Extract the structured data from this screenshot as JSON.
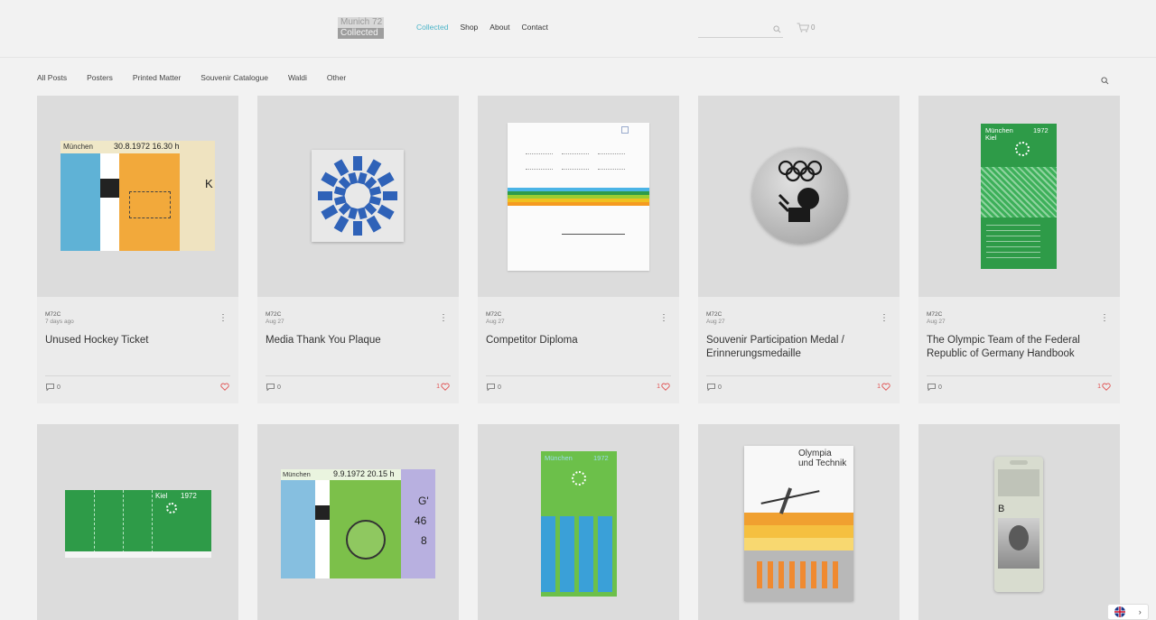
{
  "header": {
    "logo_line1": "Munich 72",
    "logo_line2": "Collected",
    "nav": [
      {
        "label": "Collected",
        "active": true
      },
      {
        "label": "Shop",
        "active": false
      },
      {
        "label": "About",
        "active": false
      },
      {
        "label": "Contact",
        "active": false
      }
    ],
    "cart_count": "0",
    "accent_color": "#4bb4c8"
  },
  "filters": [
    "All Posts",
    "Posters",
    "Printed Matter",
    "Souvenir Catalogue",
    "Waldi",
    "Other"
  ],
  "posts": [
    {
      "author": "M72C",
      "date": "7 days ago",
      "title": "Unused Hockey Ticket",
      "comments": "0",
      "likes": ""
    },
    {
      "author": "M72C",
      "date": "Aug 27",
      "title": "Media Thank You Plaque",
      "comments": "0",
      "likes": "1"
    },
    {
      "author": "M72C",
      "date": "Aug 27",
      "title": "Competitor Diploma",
      "comments": "0",
      "likes": "1"
    },
    {
      "author": "M72C",
      "date": "Aug 27",
      "title": "Souvenir Participation Medal / Erinnerungsmedaille",
      "comments": "0",
      "likes": "1"
    },
    {
      "author": "M72C",
      "date": "Aug 27",
      "title": "The Olympic Team of the Federal Republic of Germany Handbook",
      "comments": "0",
      "likes": "1"
    }
  ],
  "thumb_text": {
    "ticket1_city": "München",
    "ticket1_date": "30.8.1972 16.30 h",
    "ticket1_letter": "K",
    "handbook_city": "München",
    "handbook_sub": "Kiel",
    "handbook_year": "1972",
    "ticket2_city": "Kiel",
    "ticket2_year": "1972",
    "ticket3_city": "München",
    "ticket3_date": "9.9.1972 20.15 h",
    "ticket3_g": "G'",
    "ticket3_n1": "46",
    "ticket3_n2": "8",
    "poster_city": "München",
    "poster_year": "1972",
    "olympia_line1": "Olympia",
    "olympia_line2": "und Technik",
    "badge_letter": "B"
  },
  "language": "EN"
}
